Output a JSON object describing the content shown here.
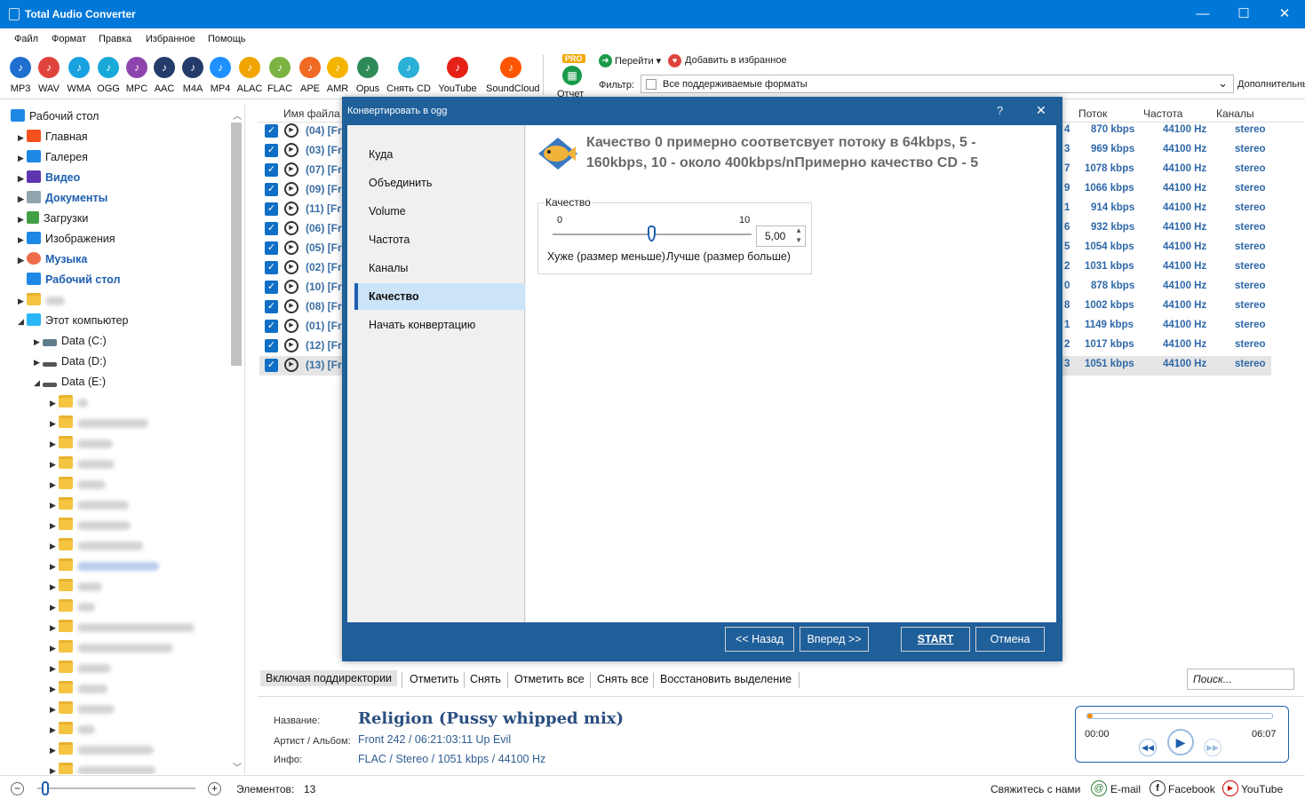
{
  "window": {
    "title": "Total Audio Converter"
  },
  "menu": [
    "Файл",
    "Формат",
    "Правка",
    "Избранное",
    "Помощь"
  ],
  "formats": [
    {
      "label": "MP3",
      "icon": "mp3-icon",
      "color": "#1e6fd0"
    },
    {
      "label": "WAV",
      "icon": "wav-icon",
      "color": "#e0433c"
    },
    {
      "label": "WMA",
      "icon": "wma-icon",
      "color": "#19a1e0"
    },
    {
      "label": "OGG",
      "icon": "ogg-icon",
      "color": "#18a9d8"
    },
    {
      "label": "MPC",
      "icon": "mpc-icon",
      "color": "#8e44ad"
    },
    {
      "label": "AAC",
      "icon": "aac-icon",
      "color": "#243b6b"
    },
    {
      "label": "M4A",
      "icon": "m4a-icon",
      "color": "#243b6b"
    },
    {
      "label": "MP4",
      "icon": "mp4-icon",
      "color": "#1e90ff"
    },
    {
      "label": "ALAC",
      "icon": "alac-icon",
      "color": "#f0a500"
    },
    {
      "label": "FLAC",
      "icon": "flac-icon",
      "color": "#7cb342"
    },
    {
      "label": "APE",
      "icon": "ape-icon",
      "color": "#f06a23"
    },
    {
      "label": "AMR",
      "icon": "amr-icon",
      "color": "#f5b400"
    },
    {
      "label": "Opus",
      "icon": "opus-icon",
      "color": "#2e8b57"
    },
    {
      "label": "Снять CD",
      "icon": "cd-icon",
      "color": "#2bb0d8"
    },
    {
      "label": "YouTube",
      "icon": "youtube-icon",
      "color": "#e62117"
    },
    {
      "label": "SoundCloud",
      "icon": "soundcloud-icon",
      "color": "#ff5500"
    }
  ],
  "toolbar": {
    "report": "Отчет",
    "pro": "PRO",
    "goto": "Перейти",
    "favorites": "Добавить в избранное",
    "filter_label": "Фильтр:",
    "filter_value": "Все поддерживаемые форматы",
    "more": "Дополнительны"
  },
  "tree": {
    "root": "Рабочий стол",
    "items": [
      "Главная",
      "Галерея",
      "Видео",
      "Документы",
      "Загрузки",
      "Изображения",
      "Музыка",
      "Рабочий стол"
    ],
    "computer": "Этот компьютер",
    "drives": [
      "Data (C:)",
      "Data (D:)",
      "Data (E:)"
    ]
  },
  "list": {
    "headers": {
      "name": "Имя файла",
      "bitrate": "Поток",
      "freq": "Частота",
      "channels": "Каналы"
    },
    "rows": [
      {
        "n": "(04) [Fr",
        "d": "4",
        "b": "870 kbps",
        "f": "44100 Hz",
        "c": "stereo"
      },
      {
        "n": "(03) [Fr",
        "d": "3",
        "b": "969 kbps",
        "f": "44100 Hz",
        "c": "stereo"
      },
      {
        "n": "(07) [Fr",
        "d": "7",
        "b": "1078 kbps",
        "f": "44100 Hz",
        "c": "stereo"
      },
      {
        "n": "(09) [Fr",
        "d": "9",
        "b": "1066 kbps",
        "f": "44100 Hz",
        "c": "stereo"
      },
      {
        "n": "(11) [Fr",
        "d": "1",
        "b": "914 kbps",
        "f": "44100 Hz",
        "c": "stereo"
      },
      {
        "n": "(06) [Fr",
        "d": "6",
        "b": "932 kbps",
        "f": "44100 Hz",
        "c": "stereo"
      },
      {
        "n": "(05) [Fr",
        "d": "5",
        "b": "1054 kbps",
        "f": "44100 Hz",
        "c": "stereo"
      },
      {
        "n": "(02) [Fr",
        "d": "2",
        "b": "1031 kbps",
        "f": "44100 Hz",
        "c": "stereo"
      },
      {
        "n": "(10) [Fr",
        "d": "0",
        "b": "878 kbps",
        "f": "44100 Hz",
        "c": "stereo"
      },
      {
        "n": "(08) [Fr",
        "d": "8",
        "b": "1002 kbps",
        "f": "44100 Hz",
        "c": "stereo"
      },
      {
        "n": "(01) [Fr",
        "d": "1",
        "b": "1149 kbps",
        "f": "44100 Hz",
        "c": "stereo"
      },
      {
        "n": "(12) [Fr",
        "d": "2",
        "b": "1017 kbps",
        "f": "44100 Hz",
        "c": "stereo"
      },
      {
        "n": "(13) [Fr",
        "d": "3",
        "b": "1051 kbps",
        "f": "44100 Hz",
        "c": "stereo"
      }
    ]
  },
  "selbar": {
    "subdirs": "Включая поддиректории",
    "check": "Отметить",
    "uncheck": "Снять",
    "check_all": "Отметить все",
    "uncheck_all": "Снять все",
    "restore": "Восстановить выделение",
    "search_placeholder": "Поиск..."
  },
  "info": {
    "name_label": "Название:",
    "name": "Religion (Pussy whipped mix)",
    "artist_label": "Артист / Альбом:",
    "artist": "Front 242 / 06:21:03:11 Up Evil",
    "info_label": "Инфо:",
    "info": "FLAC / Stereo / 1051 kbps / 44100 Hz"
  },
  "player": {
    "start": "00:00",
    "end": "06:07",
    "progress": 0.01
  },
  "status": {
    "elements_label": "Элементов:",
    "elements": "13",
    "contact": "Свяжитесь с нами",
    "email": "E-mail",
    "facebook": "Facebook",
    "youtube": "YouTube",
    "zoom": 0.12
  },
  "dialog": {
    "title": "Конвертировать в ogg",
    "help": "?",
    "nav": [
      "Куда",
      "Объединить",
      "Volume",
      "Частота",
      "Каналы",
      "Качество",
      "Начать конвертацию"
    ],
    "active_index": 5,
    "heading": "Качество 0 примерно соответсвует потоку в 64kbps, 5 - 160kbps, 10 - около 400kbps/nПримерно качество CD - 5",
    "group": "Качество",
    "min": "0",
    "max": "10",
    "value": "5,00",
    "worse": "Хуже (размер меньше)",
    "better": "Лучше (размер больше)",
    "slider_fraction": 0.5,
    "back": "<< Назад",
    "next": "Вперед >>",
    "start": "START",
    "cancel": "Отмена"
  }
}
